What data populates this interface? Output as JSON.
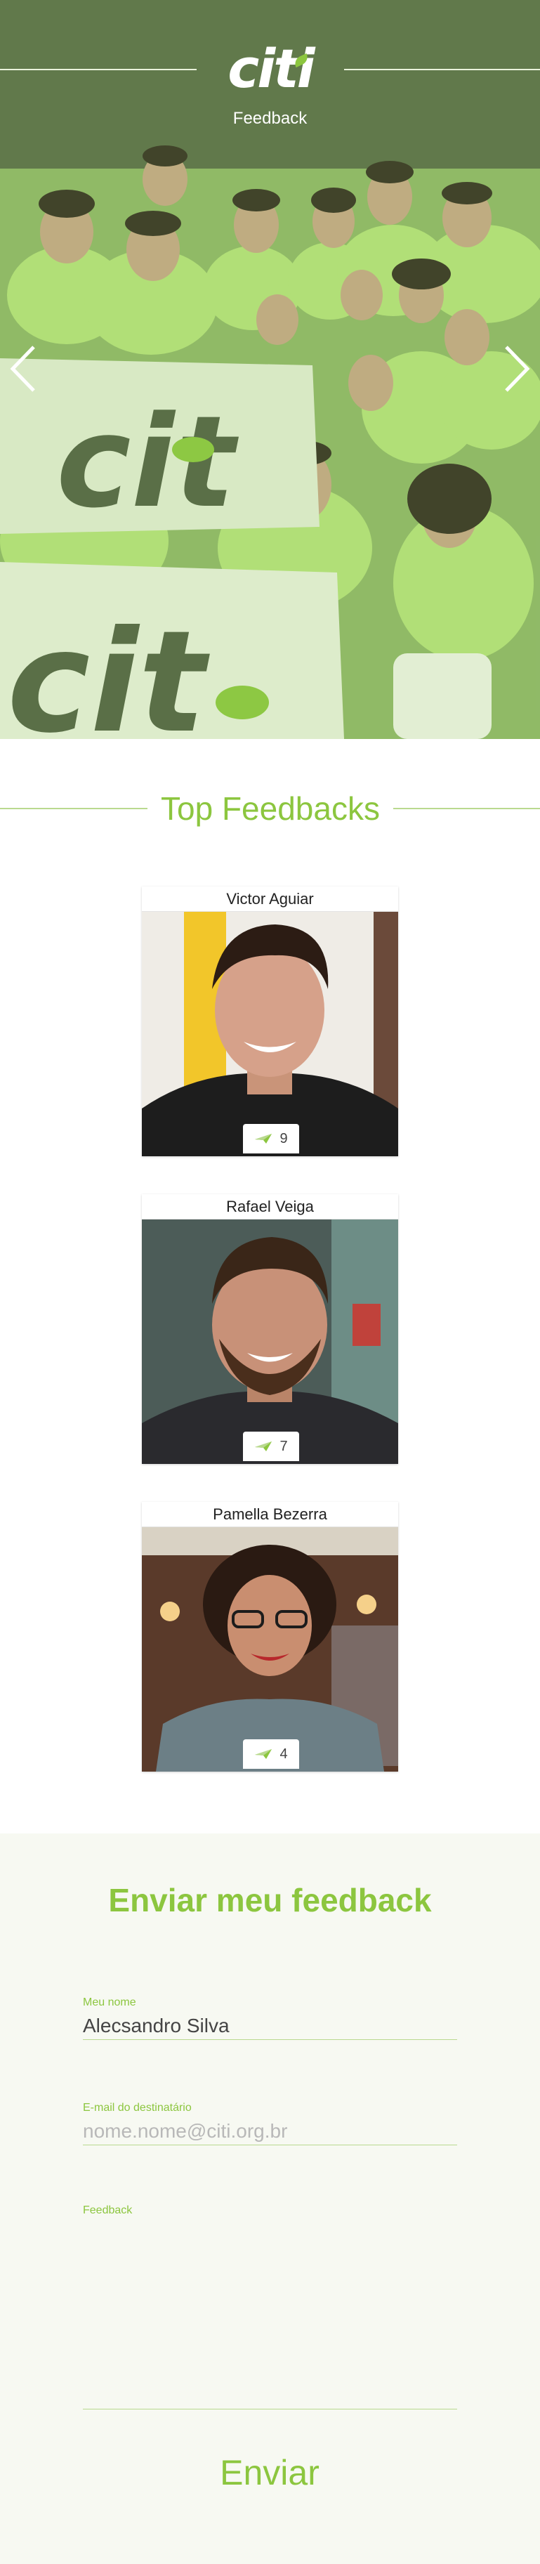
{
  "hero": {
    "logo_text": "citi",
    "subtitle": "Feedback",
    "prev_label": "Previous slide",
    "next_label": "Next slide"
  },
  "top_feedbacks": {
    "title": "Top Feedbacks",
    "cards": [
      {
        "name": "Victor Aguiar",
        "count": "9"
      },
      {
        "name": "Rafael Veiga",
        "count": "7"
      },
      {
        "name": "Pamella Bezerra",
        "count": "4"
      }
    ]
  },
  "form": {
    "title": "Enviar meu feedback",
    "name_label": "Meu nome",
    "name_value": "Alecsandro Silva",
    "email_label": "E-mail do destinatário",
    "email_placeholder": "nome.nome@citi.org.br",
    "feedback_label": "Feedback",
    "submit_label": "Enviar"
  },
  "colors": {
    "accent": "#8cc63f",
    "line": "#b9d98f",
    "form_background": "#f7f9f2"
  }
}
